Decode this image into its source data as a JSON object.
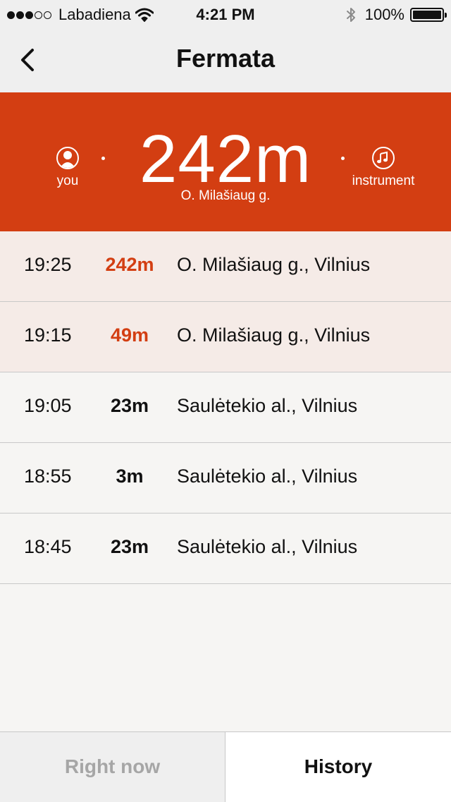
{
  "status_bar": {
    "carrier": "Labadiena",
    "time": "4:21 PM",
    "battery": "100%",
    "signal_filled": 3,
    "signal_total": 5
  },
  "nav": {
    "title": "Fermata",
    "back_icon": "chevron-left-icon"
  },
  "hero": {
    "distance": "242m",
    "street": "O. Milašiaug g.",
    "left_label": "you",
    "right_label": "instrument",
    "background_color": "#d33e12"
  },
  "history": [
    {
      "time": "19:25",
      "distance": "242m",
      "place": "O. Milašiaug g., Vilnius",
      "highlight": true
    },
    {
      "time": "19:15",
      "distance": "49m",
      "place": "O. Milašiaug g., Vilnius",
      "highlight": true
    },
    {
      "time": "19:05",
      "distance": "23m",
      "place": "Saulėtekio al., Vilnius",
      "highlight": false
    },
    {
      "time": "18:55",
      "distance": "3m",
      "place": "Saulėtekio al., Vilnius",
      "highlight": false
    },
    {
      "time": "18:45",
      "distance": "23m",
      "place": "Saulėtekio al., Vilnius",
      "highlight": false
    }
  ],
  "tabs": {
    "right_now": "Right now",
    "history": "History",
    "selected": "history"
  }
}
